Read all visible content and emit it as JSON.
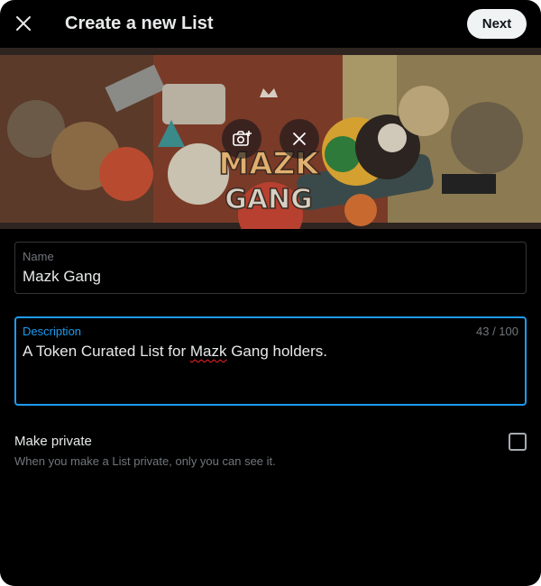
{
  "header": {
    "title": "Create a new List",
    "next_label": "Next",
    "close_icon": "close-icon"
  },
  "banner": {
    "art_text": "MAZK GANG",
    "actions": [
      "camera-add-icon",
      "close-icon"
    ]
  },
  "form": {
    "name": {
      "label": "Name",
      "value": "Mazk Gang"
    },
    "description": {
      "label": "Description",
      "value_before": "A Token Curated List for ",
      "value_misspelled": "Mazk",
      "value_after": " Gang holders.",
      "counter": "43 / 100"
    },
    "private": {
      "label": "Make private",
      "help": "When you make a List private, only you can see it.",
      "checked": false
    }
  },
  "colors": {
    "background": "#000000",
    "accent": "#1d9bf0",
    "button_bg": "#eff3f4",
    "muted_text": "#71767b"
  }
}
